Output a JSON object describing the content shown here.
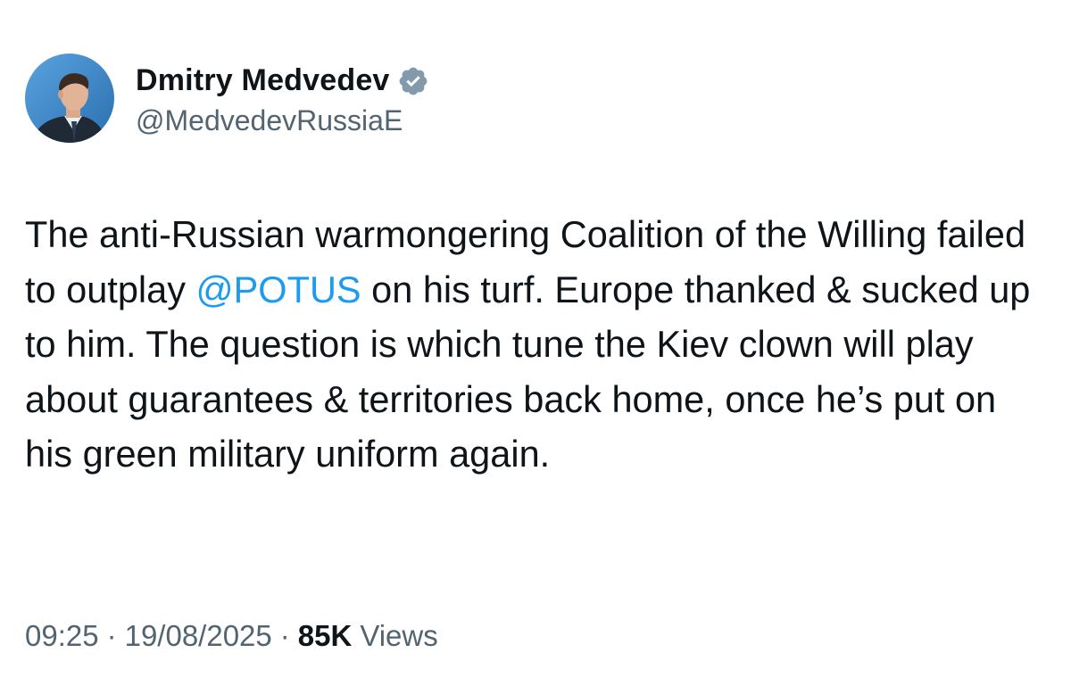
{
  "author": {
    "display_name": "Dmitry Medvedev",
    "handle": "@MedvedevRussiaE",
    "verified": true,
    "avatar_icon": "profile-photo",
    "verified_icon": "verified-badge-icon"
  },
  "tweet": {
    "text_before_mention": "The anti-Russian warmongering Coalition of the Willing failed to outplay ",
    "mention": "@POTUS",
    "text_after_mention": " on his turf. Europe thanked & sucked up to him. The question is which tune the Kiev clown will play about guarantees & territories back home, once he’s put on his green military uniform again."
  },
  "meta": {
    "time": "09:25",
    "separator": "·",
    "date": "19/08/2025",
    "views_count": "85K",
    "views_label": "Views"
  },
  "colors": {
    "text": "#0f1419",
    "secondary": "#536471",
    "link": "#1d9bf0",
    "verified_badge": "#829aab",
    "avatar_background": "#3a86c9"
  }
}
